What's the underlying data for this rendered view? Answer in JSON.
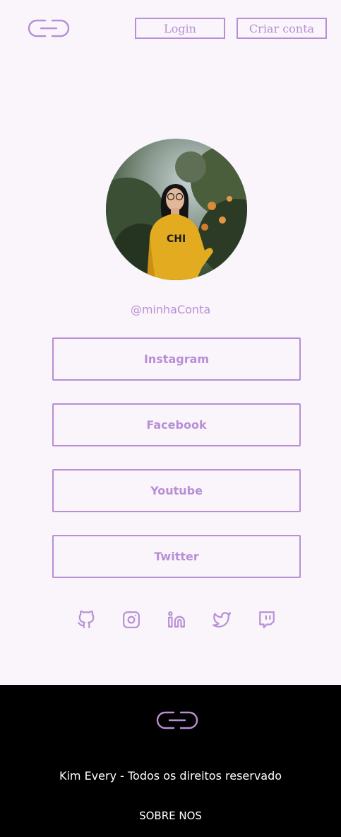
{
  "header": {
    "logo_icon": "link-chain-icon",
    "login_label": "Login",
    "signup_label": "Criar conta"
  },
  "profile": {
    "handle": "@minhaConta"
  },
  "links": [
    {
      "label": "Instagram"
    },
    {
      "label": "Facebook"
    },
    {
      "label": "Youtube"
    },
    {
      "label": "Twitter"
    }
  ],
  "social_icons": [
    "github-icon",
    "instagram-icon",
    "linkedin-icon",
    "twitter-icon",
    "twitch-icon"
  ],
  "footer": {
    "logo_icon": "link-chain-icon",
    "copyright": "Kim Every - Todos os direitos reservado",
    "about_label": "SOBRE NOS"
  },
  "colors": {
    "accent": "#b88fd6",
    "background": "#f9f5fb",
    "footer_bg": "#000000",
    "footer_text": "#ffffff"
  }
}
